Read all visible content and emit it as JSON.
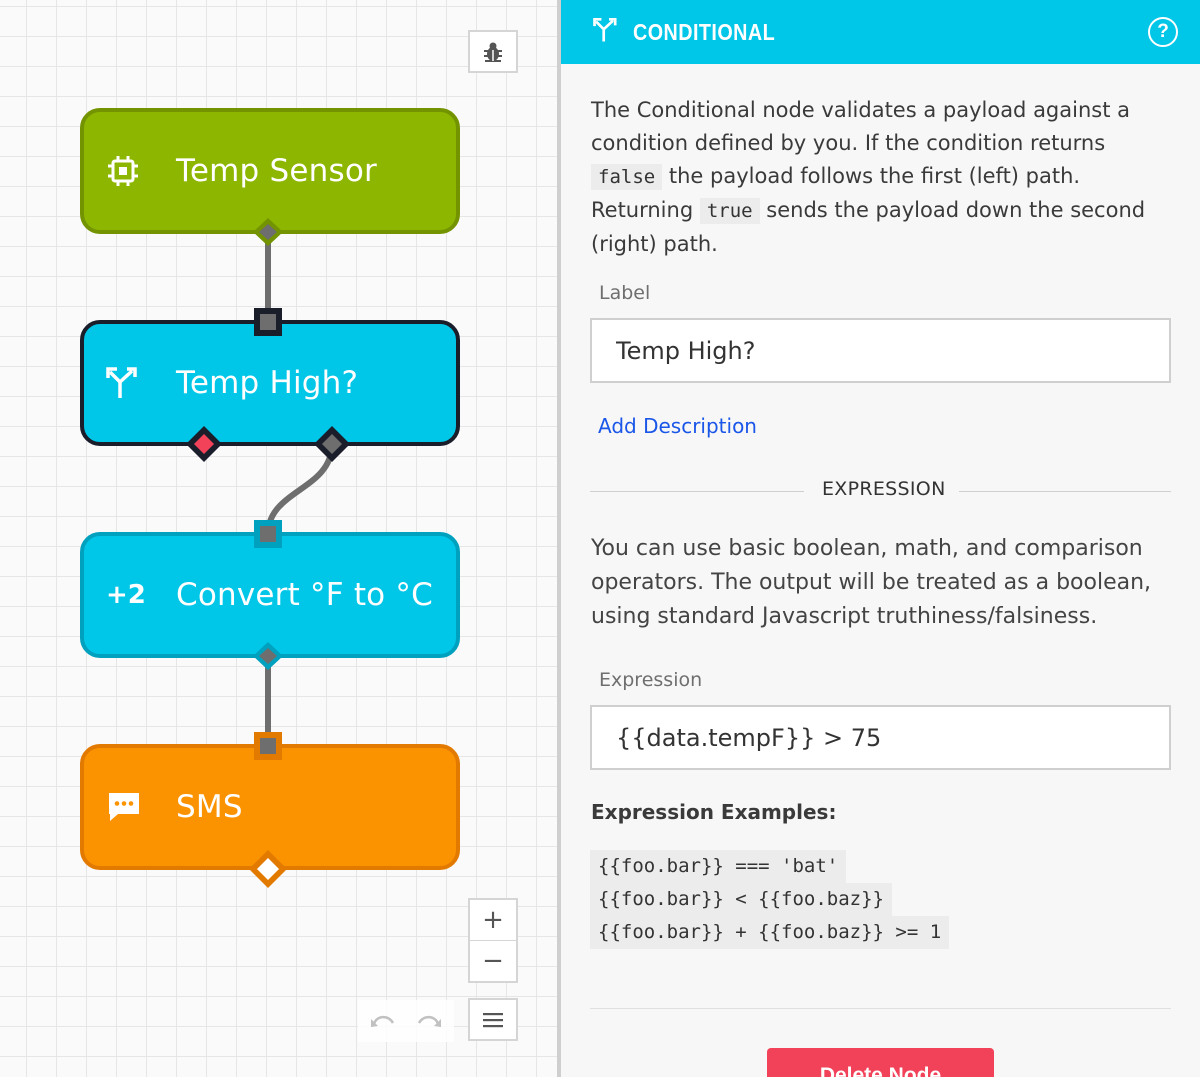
{
  "canvas": {
    "nodes": [
      {
        "label": "Temp Sensor",
        "icon": "chip-icon",
        "color": "#8db600"
      },
      {
        "label": "Temp High?",
        "icon": "fork-icon",
        "color": "#00c6e8"
      },
      {
        "label": "Convert °F to °C",
        "icon_text": "+2",
        "color": "#00c6e8"
      },
      {
        "label": "SMS",
        "icon": "chat-icon",
        "color": "#fb9300"
      }
    ],
    "toolbar": {
      "debug_icon": "bug-icon",
      "zoom_in": "+",
      "zoom_out": "−"
    }
  },
  "panel": {
    "title": "CONDITIONAL",
    "help_label": "?",
    "accent_color": "#00c6e8",
    "intro": {
      "part1": "The Conditional node validates a payload against a condition defined by you. If the condition returns ",
      "code_false": "false",
      "part2": " the payload follows the first (left) path. Returning ",
      "code_true": "true",
      "part3": " sends the payload down the second (right) path."
    },
    "label_field": {
      "label": "Label",
      "value": "Temp High?"
    },
    "add_description": "Add Description",
    "expression_heading": "EXPRESSION",
    "expression_help": "You can use basic boolean, math, and comparison operators. The output will be treated as a boolean, using standard Javascript truthiness/falsiness.",
    "expression_field": {
      "label": "Expression",
      "value": "{{data.tempF}} > 75"
    },
    "examples_title": "Expression Examples:",
    "examples": [
      "{{foo.bar}} === 'bat'",
      "{{foo.bar}} < {{foo.baz}}",
      "{{foo.bar}} + {{foo.baz}} >= 1"
    ],
    "delete_label": "Delete Node",
    "delete_color": "#f2425a"
  }
}
